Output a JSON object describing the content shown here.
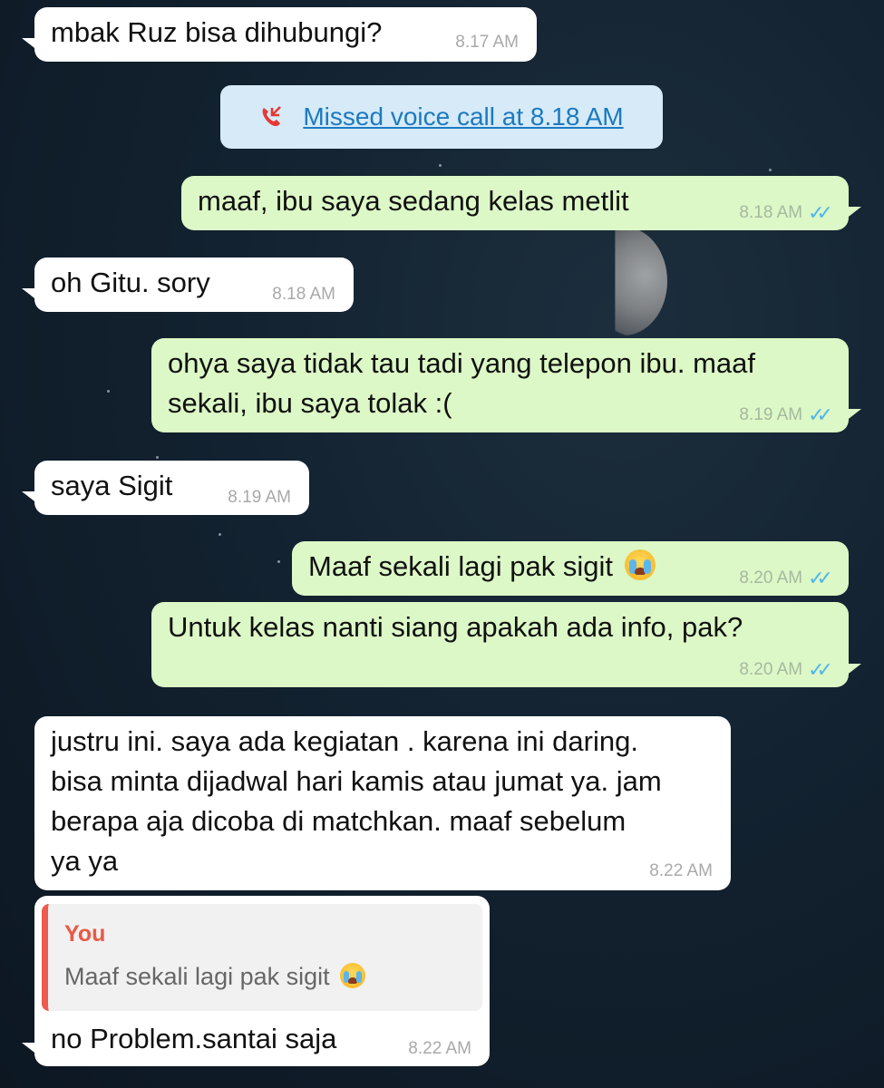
{
  "messages": [
    {
      "text": "mbak Ruz bisa dihubungi?",
      "time": "8.17 AM"
    },
    {
      "text": "maaf, ibu saya sedang kelas metlit",
      "time": "8.18 AM"
    },
    {
      "text": "oh Gitu. sory",
      "time": "8.18 AM"
    },
    {
      "lines": [
        "ohya saya tidak tau tadi yang telepon ibu. maaf",
        "sekali, ibu saya tolak :("
      ],
      "time": "8.19 AM"
    },
    {
      "text": "saya Sigit",
      "time": "8.19 AM"
    },
    {
      "text": "Maaf sekali lagi pak sigit",
      "time": "8.20 AM"
    },
    {
      "text": "Untuk kelas nanti siang apakah ada info, pak?",
      "time": "8.20 AM"
    },
    {
      "lines": [
        "justru ini. saya ada kegiatan . karena ini daring.",
        "bisa minta dijadwal hari kamis atau jumat ya. jam",
        "berapa aja dicoba di matchkan. maaf sebelum",
        "ya ya"
      ],
      "time": "8.22 AM"
    },
    {
      "text": "no Problem.santai saja",
      "time": "8.22 AM"
    }
  ],
  "missed_call": {
    "label": "Missed voice call at 8.18 AM"
  },
  "quoted_reply": {
    "author": "You",
    "text": "Maaf sekali lagi pak sigit"
  },
  "colors": {
    "incoming_bubble": "#ffffff",
    "outgoing_bubble": "#dcf8c6",
    "read_ticks": "#4fb6ec",
    "missed_call_bg": "#d6eaf8",
    "missed_call_text": "#1b7ac0",
    "quote_accent": "#ec5b4b"
  },
  "icons": {
    "missed_call": "missed-call-icon",
    "read_receipt": "double-check-icon",
    "emoji": "loudly-crying-face-emoji"
  }
}
